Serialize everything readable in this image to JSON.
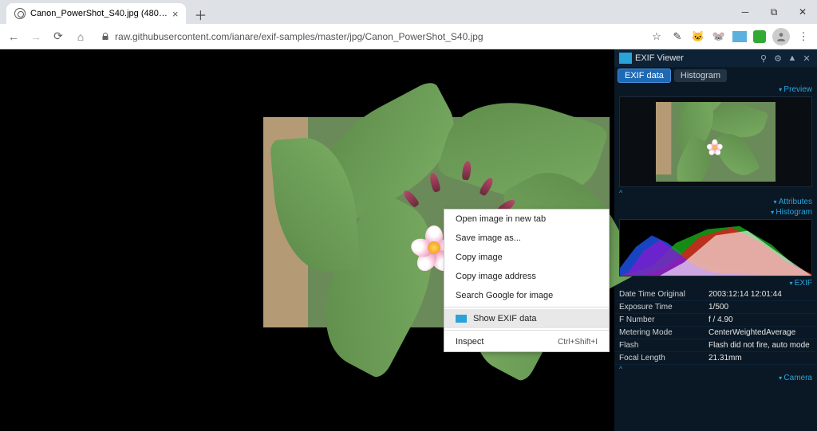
{
  "browser": {
    "tab_title": "Canon_PowerShot_S40.jpg (480…",
    "url": "raw.githubusercontent.com/ianare/exif-samples/master/jpg/Canon_PowerShot_S40.jpg"
  },
  "context_menu": {
    "items": [
      {
        "label": "Open image in new tab"
      },
      {
        "label": "Save image as..."
      },
      {
        "label": "Copy image"
      },
      {
        "label": "Copy image address"
      },
      {
        "label": "Search Google for image"
      }
    ],
    "show_exif": "Show EXIF data",
    "inspect": "Inspect",
    "inspect_shortcut": "Ctrl+Shift+I"
  },
  "panel": {
    "title": "EXIF Viewer",
    "tab_active": "EXIF data",
    "tab_inactive": "Histogram",
    "section_preview": "Preview",
    "section_attributes": "Attributes",
    "section_histogram": "Histogram",
    "section_exif": "EXIF",
    "section_camera": "Camera"
  },
  "exif": [
    {
      "k": "Date Time Original",
      "v": "2003:12:14 12:01:44"
    },
    {
      "k": "Exposure Time",
      "v": "1/500"
    },
    {
      "k": "F Number",
      "v": "f / 4.90"
    },
    {
      "k": "Metering Mode",
      "v": "CenterWeightedAverage"
    },
    {
      "k": "Flash",
      "v": "Flash did not fire, auto mode"
    },
    {
      "k": "Focal Length",
      "v": "21.31mm"
    }
  ]
}
